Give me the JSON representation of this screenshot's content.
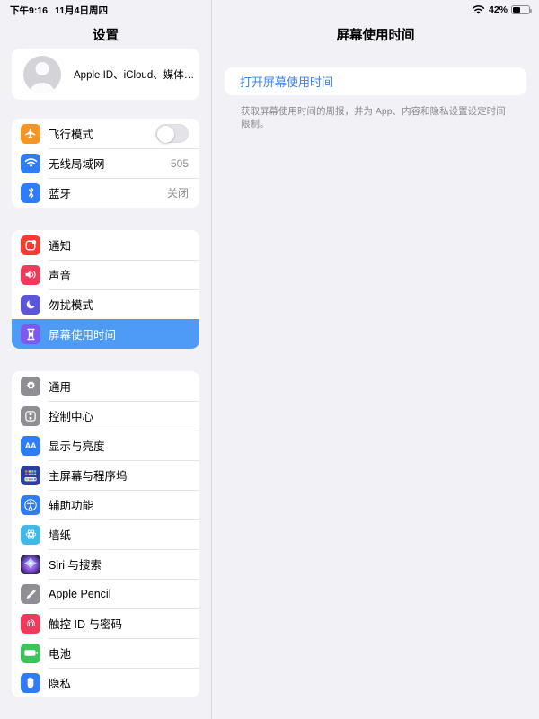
{
  "status_bar": {
    "time": "下午9:16",
    "date": "11月4日周四",
    "wifi_icon": "wifi-icon",
    "battery_percent": "42%",
    "battery_level": 42,
    "battery_icon": "battery-icon"
  },
  "sidebar": {
    "title": "设置",
    "profile": {
      "label": "Apple ID、iCloud、媒体与...",
      "avatar_icon": "person-avatar-icon"
    },
    "groups": [
      {
        "name": "connectivity",
        "items": [
          {
            "label": "飞行模式",
            "icon": "airplane-icon",
            "icon_color": "#f79522",
            "control": "toggle",
            "toggle_on": false
          },
          {
            "label": "无线局域网",
            "icon": "wifi-icon",
            "icon_color": "#2f7cf6",
            "value": "505"
          },
          {
            "label": "蓝牙",
            "icon": "bluetooth-icon",
            "icon_color": "#2f7cf6",
            "value": "关闭"
          }
        ]
      },
      {
        "name": "alerts",
        "items": [
          {
            "label": "通知",
            "icon": "notifications-icon",
            "icon_color": "#f63b30"
          },
          {
            "label": "声音",
            "icon": "sound-icon",
            "icon_color": "#ef3b5b"
          },
          {
            "label": "勿扰模式",
            "icon": "do-not-disturb-moon-icon",
            "icon_color": "#5a56d6"
          },
          {
            "label": "屏幕使用时间",
            "icon": "hourglass-icon",
            "icon_color": "#7a5af0",
            "selected": true
          }
        ]
      },
      {
        "name": "system",
        "items": [
          {
            "label": "通用",
            "icon": "gear-icon",
            "icon_color": "#8e8e93"
          },
          {
            "label": "控制中心",
            "icon": "control-center-icon",
            "icon_color": "#8e8e93"
          },
          {
            "label": "显示与亮度",
            "icon": "display-brightness-aa-icon",
            "icon_color": "#2f7cf6"
          },
          {
            "label": "主屏幕与程序坞",
            "icon": "home-screen-dock-icon",
            "icon_color": "#2b3fa0"
          },
          {
            "label": "辅助功能",
            "icon": "accessibility-icon",
            "icon_color": "#2f7cf6"
          },
          {
            "label": "墙纸",
            "icon": "wallpaper-flower-icon",
            "icon_color": "#41b8e8"
          },
          {
            "label": "Siri 与搜索",
            "icon": "siri-icon",
            "icon_color": "#1c1c2e"
          },
          {
            "label": "Apple Pencil",
            "icon": "apple-pencil-icon",
            "icon_color": "#8e8e93"
          },
          {
            "label": "触控 ID 与密码",
            "icon": "touch-id-fingerprint-icon",
            "icon_color": "#ef3b5b"
          },
          {
            "label": "电池",
            "icon": "battery-icon",
            "icon_color": "#3ec25b"
          },
          {
            "label": "隐私",
            "icon": "privacy-hand-icon",
            "icon_color": "#2f7cf6"
          }
        ]
      }
    ]
  },
  "detail": {
    "title": "屏幕使用时间",
    "turn_on_label": "打开屏幕使用时间",
    "footer": "获取屏幕使用时间的周报，并为 App、内容和隐私设置设定时间限制。"
  },
  "colors": {
    "background": "#f2f1f6",
    "card": "#ffffff",
    "selected": "#4e9bf5",
    "link": "#3d7fe8",
    "secondary_text": "#8e8e93"
  }
}
